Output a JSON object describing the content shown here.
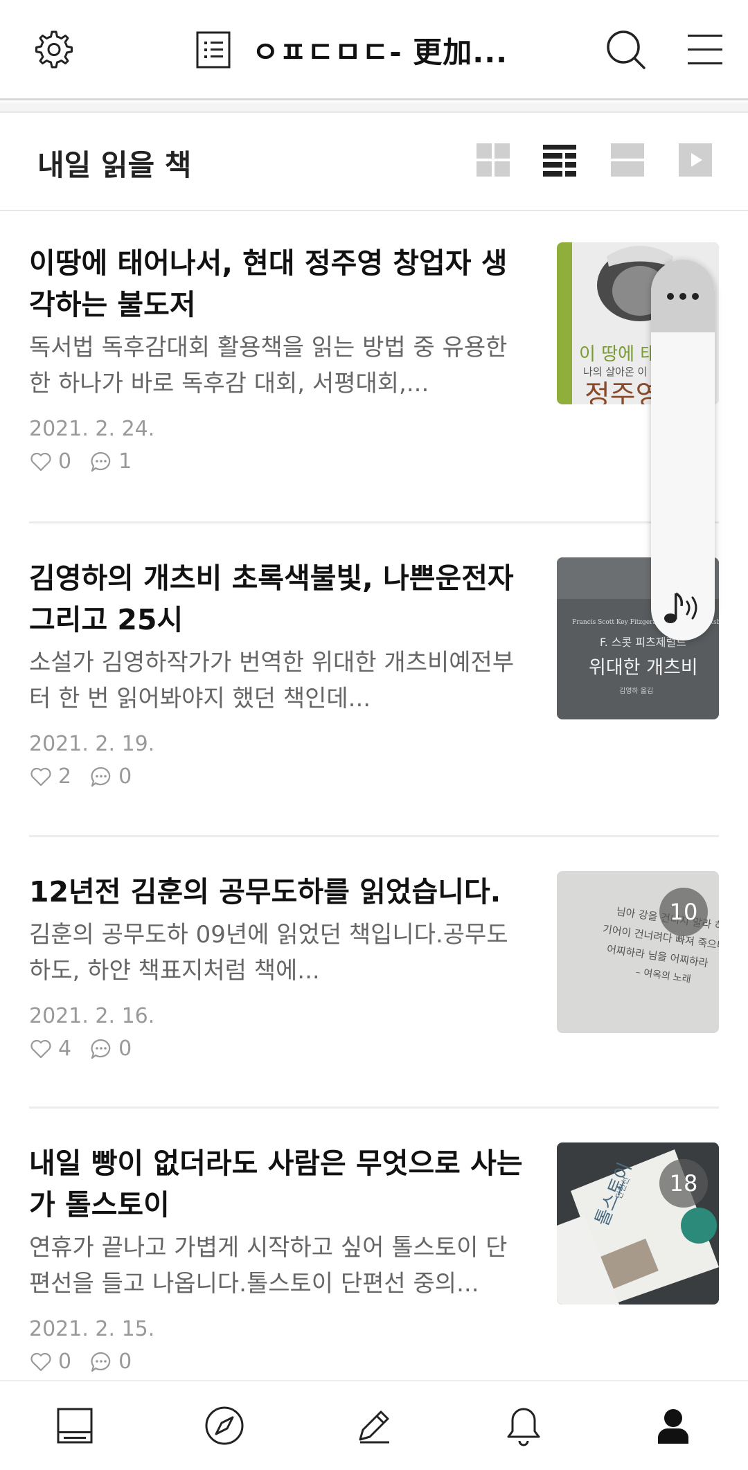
{
  "header": {
    "title": "ㅇㅍㄷㅁㄷ- 更加...",
    "icons": [
      "gear-icon",
      "document-icon",
      "search-icon",
      "hamburger-menu-icon"
    ]
  },
  "section": {
    "title": "내일 읽을 책",
    "view_modes": [
      "grid-view-icon",
      "list-view-icon",
      "wide-view-icon",
      "slideshow-icon"
    ],
    "active_view": "list-view-icon"
  },
  "posts": [
    {
      "title": "이땅에 태어나서, 현대 정주영 창업자 생각하는 불도저",
      "snippet": "독서법 독후감대회 활용책을 읽는 방법 중 유용한 한 하나가 바로 독후감 대회, 서평대회,...",
      "date": "2021. 2. 24.",
      "likes": "0",
      "comments": "1",
      "thumb_text_1": "이 땅에 태어",
      "thumb_text_2": "나의 살아온 이",
      "thumb_text_3": "정주영"
    },
    {
      "title": "김영하의 개츠비 초록색불빛, 나쁜운전자 그리고 25시",
      "snippet": "소설가 김영하작가가 번역한 위대한 개츠비예전부터 한 번 읽어봐야지 했던 책인데...",
      "date": "2021. 2. 19.",
      "likes": "2",
      "comments": "0",
      "thumb_text_1": "Francis Scott Key Fitzgerald / The Great Gatsby",
      "thumb_text_2": "F. 스콧 피츠제럴드",
      "thumb_text_3": "위대한 개츠비",
      "thumb_text_4": "김영하 옮김"
    },
    {
      "title": "12년전 김훈의 공무도하를 읽었습니다.",
      "snippet": "김훈의 공무도하 09년에 읽었던 책입니다.공무도하도, 하얀 책표지처럼 책에...",
      "date": "2021. 2. 16.",
      "likes": "4",
      "comments": "0",
      "badge": "10",
      "thumb_text_1": "님아 강을 건너지 말라 하도",
      "thumb_text_2": "기어이 건너려다 빠져 죽으니",
      "thumb_text_3": "어찌하라 님을 어찌하라",
      "thumb_text_4": "– 여옥의 노래"
    },
    {
      "title": "내일 빵이 없더라도 사람은 무엇으로 사는가 톨스토이",
      "snippet": "연휴가 끝나고 가볍게 시작하고 싶어 톨스토이 단편선을 들고 나옵니다.톨스토이 단편선 중의...",
      "date": "2021. 2. 15.",
      "likes": "0",
      "comments": "0",
      "badge": "18",
      "thumb_text_1": "톨스토이",
      "thumb_text_2": "단편선"
    }
  ],
  "float_widget": {
    "icons": [
      "more-dots-icon",
      "music-sound-icon"
    ]
  },
  "bottom_nav": {
    "items": [
      "feed-icon",
      "compass-icon",
      "pencil-icon",
      "bell-icon",
      "profile-icon"
    ],
    "active": "profile-icon"
  },
  "colors": {
    "accent": "#111111",
    "muted_text": "#666666",
    "date_text": "#999999",
    "divider": "#ececec"
  }
}
